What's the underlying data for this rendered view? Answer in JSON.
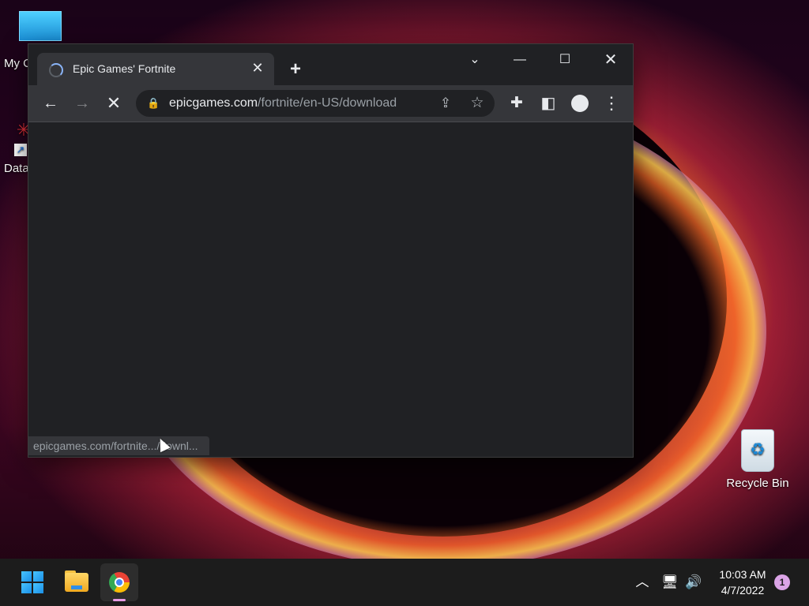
{
  "desktop": {
    "icons": [
      {
        "label": "My C"
      },
      {
        "label": "Data"
      },
      {
        "label": "Recycle Bin"
      }
    ]
  },
  "browser": {
    "tab": {
      "title": "Epic Games' Fortnite"
    },
    "url": {
      "host": "epicgames.com",
      "path": "/fortnite/en-US/download"
    },
    "status_text": "epicgames.com/fortnite.../downl..."
  },
  "taskbar": {
    "time": "10:03 AM",
    "date": "4/7/2022",
    "notification_count": "1"
  },
  "colors": {
    "browser_bg": "#202124",
    "toolbar_bg": "#35363a",
    "taskbar_bg": "#1c1c1c",
    "accent": "#8ab4f8"
  }
}
